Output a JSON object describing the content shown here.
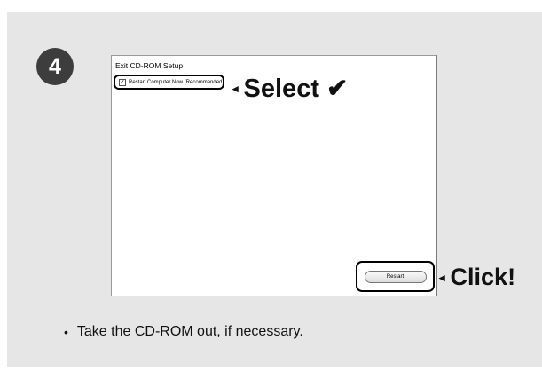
{
  "step": {
    "number": "4"
  },
  "window": {
    "title": "Exit CD-ROM Setup",
    "checkbox": {
      "label": "Restart Computer Now (Recommended)",
      "checked": true,
      "mark": "✓"
    },
    "restart_button_label": "Restart"
  },
  "callouts": {
    "select_arrow": "◂",
    "select_text": "Select ✔",
    "click_arrow": "◂",
    "click_text": "Click!"
  },
  "instructions": {
    "bullet": "•",
    "text": "Take the CD-ROM out, if necessary."
  },
  "colors": {
    "panel_background": "#e6e6e6",
    "badge_background": "#3d3d3d"
  }
}
